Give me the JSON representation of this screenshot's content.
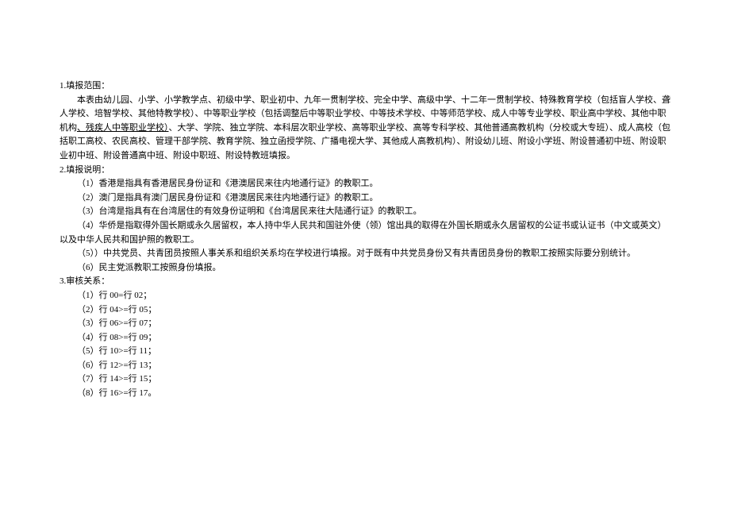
{
  "section1": {
    "header": "1.填报范围：",
    "body_prefix": "本表由幼儿园、小学、小学教学点、初级中学、职业初中、九年一贯制学校、完全中学、高级中学、十二年一贯制学校、特殊教育学校（包括盲人学校、聋人学校、培智学校、其他特教学校）、中等职业学校（包括调整后中等职业学校、中等技术学校、中等师范学校、成人中等专业学校、职业高中学校、其他中职机构",
    "body_underline": "、残疾人中等职业学校）",
    "body_suffix": "、大学、学院、独立学院、本科层次职业学校、高等职业学校、高等专科学校、其他普通高教机构（分校或大专班）、成人高校（包括职工高校、农民高校、管理干部学院、教育学院、独立函授学院、广播电视大学、其他成人高教机构）、附设幼儿班、附设小学班、附设普通初中班、附设职业初中班、附设普通高中班、附设中职班、附设特教班填报。"
  },
  "section2": {
    "header": "2.填报说明：",
    "items": [
      "（1）香港是指具有香港居民身份证和《港澳居民来往内地通行证》的教职工。",
      "（2）澳门是指具有澳门居民身份证和《港澳居民来往内地通行证》的教职工。",
      "（3）台湾是指具有在台湾居住的有效身份证明和《台湾居民来往大陆通行证》的教职工。",
      "（4）华侨是指取得外国长期或永久居留权，本人持中华人民共和国驻外使（领）馆出具的取得在外国长期或永久居留权的公证书或认证书（中文或英文）以及中华人民共和国护照的教职工。",
      "（5））中共党员、共青团员按照人事关系和组织关系均在学校进行填报。对于既有中共党员身份又有共青团员身份的教职工按照实际要分别统计。",
      "（6）民主党派教职工按照身份填报。"
    ]
  },
  "section3": {
    "header": "3.审核关系：",
    "items": [
      "（1）行 00=行 02；",
      "（2）行 04>=行 05；",
      "（3）行 06>=行 07；",
      "（4）行 08>=行 09；",
      "（5）行 10>=行 11；",
      "（6）行 12>=行 13；",
      "（7）行 14>=行 15；",
      "（8）行 16>=行 17。"
    ]
  }
}
